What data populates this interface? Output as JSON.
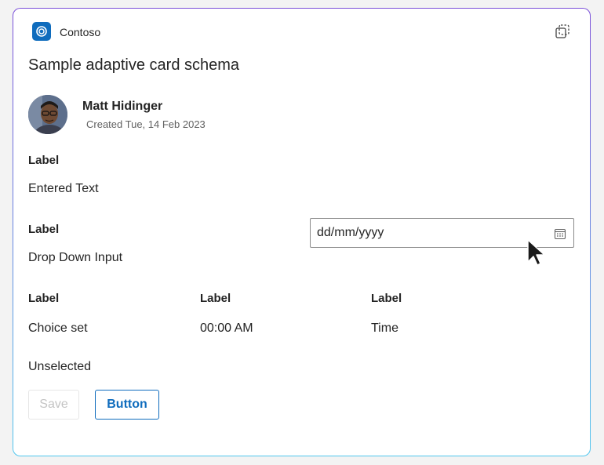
{
  "card": {
    "app_name": "Contoso",
    "title": "Sample adaptive card schema",
    "author_name": "Matt Hidinger",
    "created": "Created Tue, 14 Feb 2023"
  },
  "fields": {
    "row1": {
      "label": "Label",
      "value": "Entered Text"
    },
    "row2": {
      "label": "Label",
      "value": "Drop Down Input",
      "date_placeholder": "dd/mm/yyyy"
    },
    "row3": [
      {
        "label": "Label",
        "value": "Choice set"
      },
      {
        "label": "Label",
        "value": "00:00 AM"
      },
      {
        "label": "Label",
        "value": "Time"
      }
    ],
    "unselected": "Unselected"
  },
  "actions": {
    "save_label": "Save",
    "button_label": "Button"
  },
  "icons": {
    "app": "contoso-logo-icon",
    "popout": "popout-icon",
    "calendar": "calendar-icon",
    "cursor": "mouse-pointer-icon"
  },
  "colors": {
    "accent": "#0f6cbd",
    "border_top": "#7b4fd9",
    "border_bottom": "#4fc6ee",
    "disabled_text": "#c4c4c4"
  }
}
